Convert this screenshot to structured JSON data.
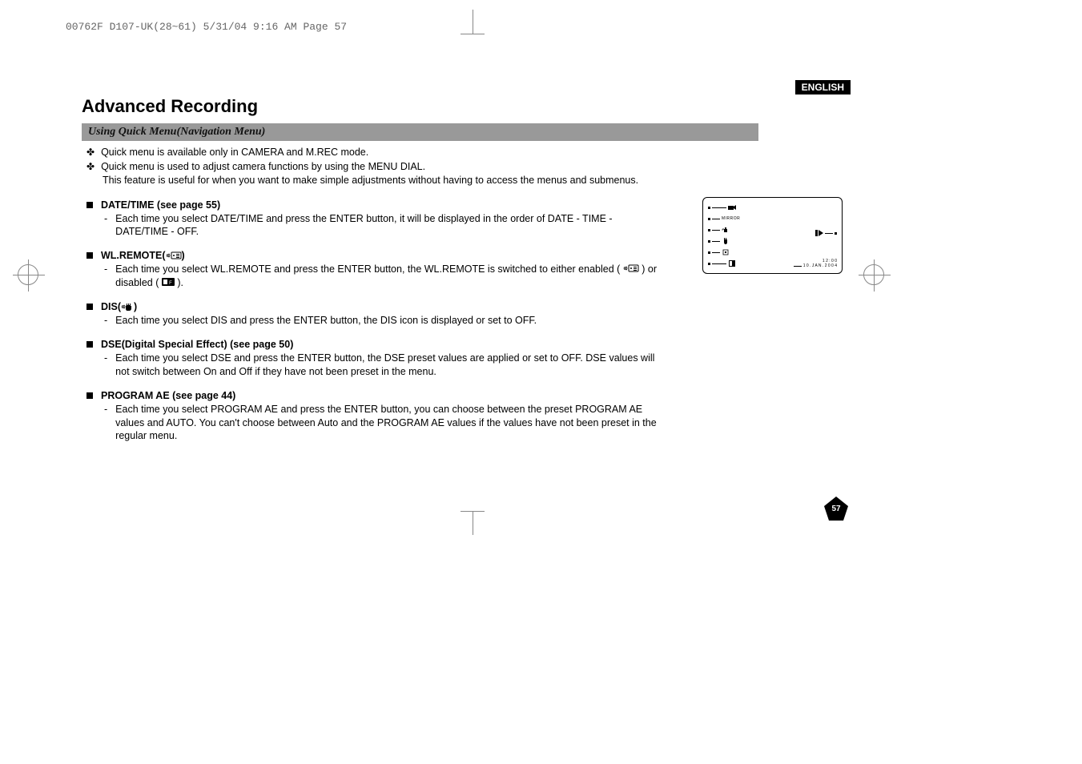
{
  "print_header": "00762F D107-UK(28~61)  5/31/04 9:16 AM  Page 57",
  "lang_badge": "ENGLISH",
  "page_title": "Advanced Recording",
  "section_bar": "Using Quick Menu(Navigation Menu)",
  "intro": {
    "line1": "Quick menu is available only in CAMERA and M.REC mode.",
    "line2": "Quick menu is used to adjust camera functions by using the MENU DIAL.",
    "line2b": "This feature is useful for when you want to make simple adjustments without having to access the menus and submenus."
  },
  "topics": {
    "datetime": {
      "heading": "DATE/TIME (see page 55)",
      "body": "Each time you select DATE/TIME and press the ENTER button, it will be displayed in the order of DATE - TIME - DATE/TIME - OFF."
    },
    "wlremote": {
      "heading_prefix": "WL.REMOTE(",
      "heading_suffix": ")",
      "body_prefix": "Each time you select WL.REMOTE and press the ENTER button, the WL.REMOTE is switched to either enabled (",
      "body_mid": ") or disabled (",
      "body_suffix": ")."
    },
    "dis": {
      "heading_prefix": "DIS(",
      "heading_suffix": ")",
      "body": "Each time you select DIS and press the ENTER button, the DIS icon is displayed or set to OFF."
    },
    "dse": {
      "heading": "DSE(Digital Special Effect) (see page 50)",
      "body": "Each time you select DSE and press the ENTER button, the DSE preset values are applied or set to OFF. DSE values will not switch between On and Off if they have not been preset in the menu."
    },
    "programae": {
      "heading": "PROGRAM AE (see page 44)",
      "body": "Each time you select PROGRAM AE and press the ENTER button, you can choose between the preset PROGRAM AE values and AUTO. You can't choose between Auto and the PROGRAM AE values if the values have not been preset in the regular menu."
    }
  },
  "screen": {
    "mirror": "MIRROR",
    "time": "1 2 : 0 0",
    "date": "1 0 . J A N .  2 0 0 4"
  },
  "page_number": "57"
}
